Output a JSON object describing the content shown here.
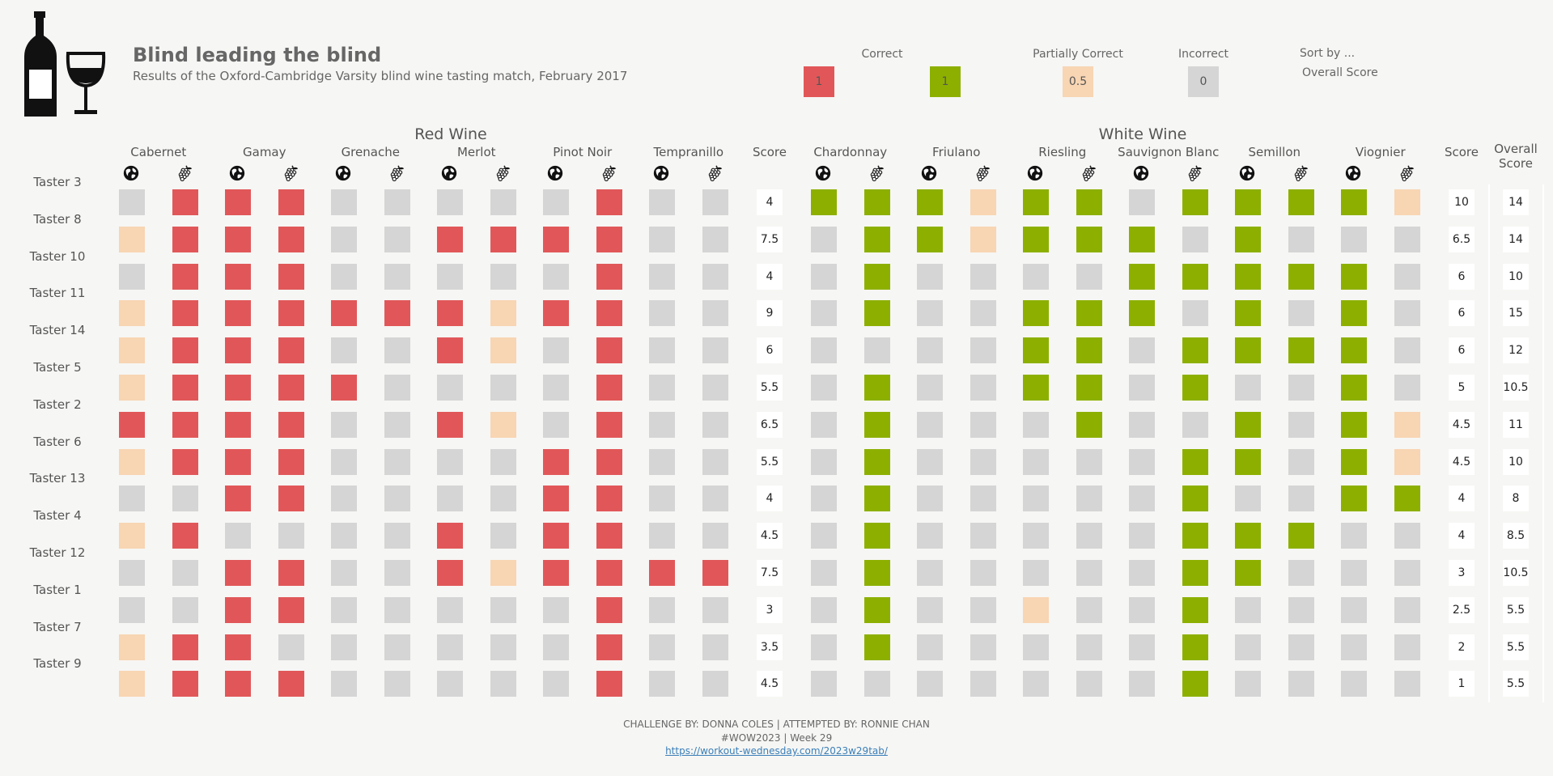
{
  "header": {
    "title": "Blind leading the blind",
    "subtitle": "Results of the Oxford-Cambridge Varsity blind wine tasting match, February 2017"
  },
  "legend": {
    "correct_label": "Correct",
    "partial_label": "Partially Correct",
    "incorrect_label": "Incorrect",
    "correct_red_value": "1",
    "correct_white_value": "1",
    "partial_value": "0.5",
    "incorrect_value": "0",
    "sort_label": "Sort by ...",
    "sort_value": "Overall Score"
  },
  "colors": {
    "red_correct": "#e15759",
    "white_correct": "#8db000",
    "partial": "#f8d5b3",
    "incorrect": "#d5d5d5",
    "background": "#f6f6f4"
  },
  "icons": {
    "country": "globe-icon",
    "grape": "grape-icon"
  },
  "chart_data": {
    "type": "heatmap",
    "groups": [
      {
        "name": "Red Wine",
        "wines": [
          "Cabernet",
          "Gamay",
          "Grenache",
          "Merlot",
          "Pinot Noir",
          "Tempranillo"
        ],
        "score_label": "Score"
      },
      {
        "name": "White Wine",
        "wines": [
          "Chardonnay",
          "Friulano",
          "Riesling",
          "Sauvignon Blanc",
          "Semillon",
          "Viognier"
        ],
        "score_label": "Score"
      }
    ],
    "overall_label": "Overall Score",
    "column_order": "each wine has two columns: country (globe) then grape",
    "value_meaning": {
      "1": "Correct",
      "0.5": "Partially Correct",
      "0": "Incorrect"
    },
    "tasters": [
      {
        "name": "Taster 3",
        "red": [
          0,
          1,
          1,
          1,
          0,
          0,
          0,
          0,
          0,
          1,
          0,
          0
        ],
        "red_score": "4",
        "white": [
          1,
          1,
          1,
          0.5,
          1,
          1,
          0,
          1,
          1,
          1,
          1,
          0.5
        ],
        "white_score": "10",
        "overall": "14"
      },
      {
        "name": "Taster 8",
        "red": [
          0.5,
          1,
          1,
          1,
          0,
          0,
          1,
          1,
          1,
          1,
          0,
          0
        ],
        "red_score": "7.5",
        "white": [
          0,
          1,
          1,
          0.5,
          1,
          1,
          1,
          0,
          1,
          0,
          0,
          0
        ],
        "white_score": "6.5",
        "overall": "14"
      },
      {
        "name": "Taster 10",
        "red": [
          0,
          1,
          1,
          1,
          0,
          0,
          0,
          0,
          0,
          1,
          0,
          0
        ],
        "red_score": "4",
        "white": [
          0,
          1,
          0,
          0,
          0,
          0,
          1,
          1,
          1,
          1,
          1,
          0
        ],
        "white_score": "6",
        "overall": "10"
      },
      {
        "name": "Taster 11",
        "red": [
          0.5,
          1,
          1,
          1,
          1,
          1,
          1,
          0.5,
          1,
          1,
          0,
          0
        ],
        "red_score": "9",
        "white": [
          0,
          1,
          0,
          0,
          1,
          1,
          1,
          0,
          1,
          0,
          1,
          0
        ],
        "white_score": "6",
        "overall": "15"
      },
      {
        "name": "Taster 14",
        "red": [
          0.5,
          1,
          1,
          1,
          0,
          0,
          1,
          0.5,
          0,
          1,
          0,
          0
        ],
        "red_score": "6",
        "white": [
          0,
          0,
          0,
          0,
          1,
          1,
          0,
          1,
          1,
          1,
          1,
          0
        ],
        "white_score": "6",
        "overall": "12"
      },
      {
        "name": "Taster 5",
        "red": [
          0.5,
          1,
          1,
          1,
          1,
          0,
          0,
          0,
          0,
          1,
          0,
          0
        ],
        "red_score": "5.5",
        "white": [
          0,
          1,
          0,
          0,
          1,
          1,
          0,
          1,
          0,
          0,
          1,
          0
        ],
        "white_score": "5",
        "overall": "10.5"
      },
      {
        "name": "Taster 2",
        "red": [
          1,
          1,
          1,
          1,
          0,
          0,
          1,
          0.5,
          0,
          1,
          0,
          0
        ],
        "red_score": "6.5",
        "white": [
          0,
          1,
          0,
          0,
          0,
          1,
          0,
          0,
          1,
          0,
          1,
          0.5
        ],
        "white_score": "4.5",
        "overall": "11"
      },
      {
        "name": "Taster 6",
        "red": [
          0.5,
          1,
          1,
          1,
          0,
          0,
          0,
          0,
          1,
          1,
          0,
          0
        ],
        "red_score": "5.5",
        "white": [
          0,
          1,
          0,
          0,
          0,
          0,
          0,
          1,
          1,
          0,
          1,
          0.5
        ],
        "white_score": "4.5",
        "overall": "10"
      },
      {
        "name": "Taster 13",
        "red": [
          0,
          0,
          1,
          1,
          0,
          0,
          0,
          0,
          1,
          1,
          0,
          0
        ],
        "red_score": "4",
        "white": [
          0,
          1,
          0,
          0,
          0,
          0,
          0,
          1,
          0,
          0,
          1,
          1
        ],
        "white_score": "4",
        "overall": "8"
      },
      {
        "name": "Taster 4",
        "red": [
          0.5,
          1,
          0,
          0,
          0,
          0,
          1,
          0,
          1,
          1,
          0,
          0
        ],
        "red_score": "4.5",
        "white": [
          0,
          1,
          0,
          0,
          0,
          0,
          0,
          1,
          1,
          1,
          0,
          0
        ],
        "white_score": "4",
        "overall": "8.5"
      },
      {
        "name": "Taster 12",
        "red": [
          0,
          0,
          1,
          1,
          0,
          0,
          1,
          0.5,
          1,
          1,
          1,
          1
        ],
        "red_score": "7.5",
        "white": [
          0,
          1,
          0,
          0,
          0,
          0,
          0,
          1,
          1,
          0,
          0,
          0
        ],
        "white_score": "3",
        "overall": "10.5"
      },
      {
        "name": "Taster 1",
        "red": [
          0,
          0,
          1,
          1,
          0,
          0,
          0,
          0,
          0,
          1,
          0,
          0
        ],
        "red_score": "3",
        "white": [
          0,
          1,
          0,
          0,
          0.5,
          0,
          0,
          1,
          0,
          0,
          0,
          0
        ],
        "white_score": "2.5",
        "overall": "5.5"
      },
      {
        "name": "Taster 7",
        "red": [
          0.5,
          1,
          1,
          0,
          0,
          0,
          0,
          0,
          0,
          1,
          0,
          0
        ],
        "red_score": "3.5",
        "white": [
          0,
          1,
          0,
          0,
          0,
          0,
          0,
          1,
          0,
          0,
          0,
          0
        ],
        "white_score": "2",
        "overall": "5.5"
      },
      {
        "name": "Taster 9",
        "red": [
          0.5,
          1,
          1,
          1,
          0,
          0,
          0,
          0,
          0,
          1,
          0,
          0
        ],
        "red_score": "4.5",
        "white": [
          0,
          0,
          0,
          0,
          0,
          0,
          0,
          1,
          0,
          0,
          0,
          0
        ],
        "white_score": "1",
        "overall": "5.5"
      }
    ]
  },
  "footer": {
    "line1": "CHALLENGE BY: DONNA COLES | ATTEMPTED BY: RONNIE CHAN",
    "line2": "#WOW2023 | Week 29",
    "link": "https://workout-wednesday.com/2023w29tab/"
  }
}
